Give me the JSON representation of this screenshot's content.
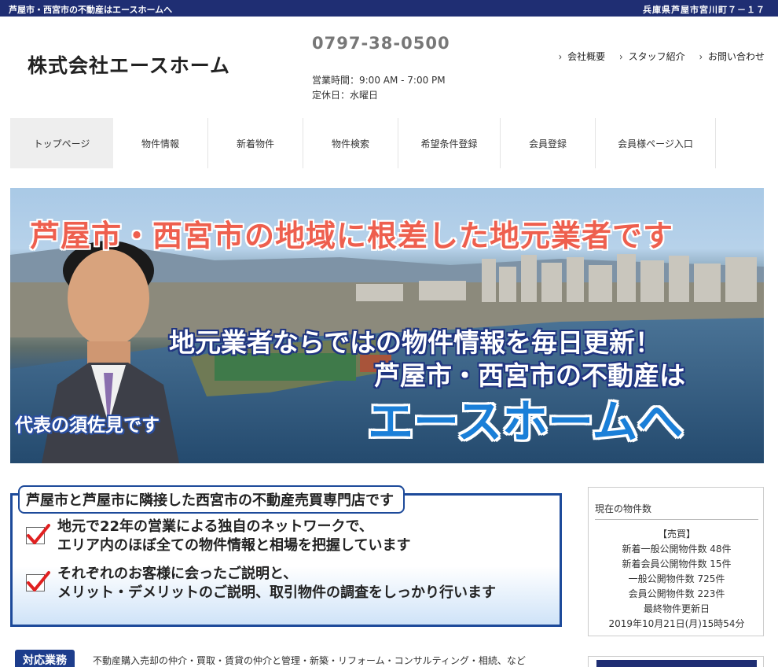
{
  "topbar": {
    "left": "芦屋市・西宮市の不動産はエースホームへ",
    "right": "兵庫県芦屋市宮川町７－１７"
  },
  "header": {
    "company": "株式会社エースホーム",
    "phone": "0797-38-0500",
    "hours": "営業時間：9:00 AM - 7:00 PM",
    "holiday": "定休日：水曜日",
    "links": [
      "会社概要",
      "スタッフ紹介",
      "お問い合わせ"
    ]
  },
  "nav": {
    "items": [
      "トップページ",
      "物件情報",
      "新着物件",
      "物件検索",
      "希望条件登録",
      "会員登録",
      "会員様ページ入口"
    ],
    "active_index": 0
  },
  "hero": {
    "headline": "芦屋市・西宮市の地域に根差した地元業者です",
    "line2": "地元業者ならではの物件情報を毎日更新！",
    "line3": "芦屋市・西宮市の不動産は",
    "line4": "エースホームへ",
    "caption": "代表の須佐見です"
  },
  "feature": {
    "title": "芦屋市と芦屋市に隣接した西宮市の不動産売買専門店です",
    "points": [
      {
        "l1": "地元で22年の営業による独自のネットワークで、",
        "l2": "エリア内のほぼ全ての物件情報と相場を把握しています"
      },
      {
        "l1": "それぞれのお客様に会ったご説明と、",
        "l2": "メリット・デメリットのご説明、取引物件の調査をしっかり行います"
      }
    ]
  },
  "sidebar": {
    "title": "現在の物件数",
    "lines": [
      "【売買】",
      "新着一般公開物件数 48件",
      "新着会員公開物件数 15件",
      "一般公開物件数 725件",
      "会員公開物件数 223件",
      "最終物件更新日",
      "2019年10月21日(月)15時54分"
    ]
  },
  "business": {
    "tag": "対応業務",
    "text": "不動産購入売却の仲介・買取・賃貸の仲介と管理・新築・リフォーム・コンサルティング・相続、など"
  },
  "colors": {
    "navy": "#1f2e73",
    "hero_red": "#ee5f4e",
    "hero_blue": "#1a7fd8",
    "check_red": "#e02020"
  }
}
